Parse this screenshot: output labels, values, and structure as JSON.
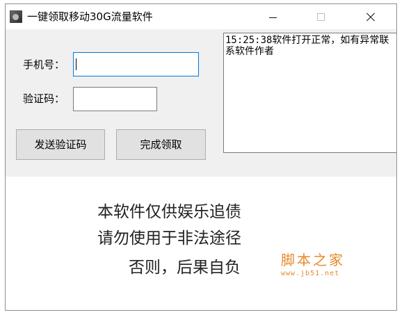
{
  "window": {
    "title": "一键领取移动30G流量软件",
    "icon": "app-avatar-icon"
  },
  "form": {
    "phone_label": "手机号：",
    "phone_value": "",
    "code_label": "验证码：",
    "code_value": "",
    "send_button": "发送验证码",
    "finish_button": "完成领取"
  },
  "log": {
    "text": "15:25:38软件打开正常，如有异常联系软件作者"
  },
  "banner": {
    "line1": "本软件仅供娱乐追债",
    "line2": "请勿使用于非法途径",
    "line3": "否则，后果自负"
  },
  "watermark": {
    "title": "脚本之家",
    "url": "www.jb51.net"
  },
  "colors": {
    "form_bg": "#f0f0f0",
    "focus_border": "#0078d7",
    "button_bg": "#e1e1e1",
    "watermark": "#e58a2a"
  }
}
